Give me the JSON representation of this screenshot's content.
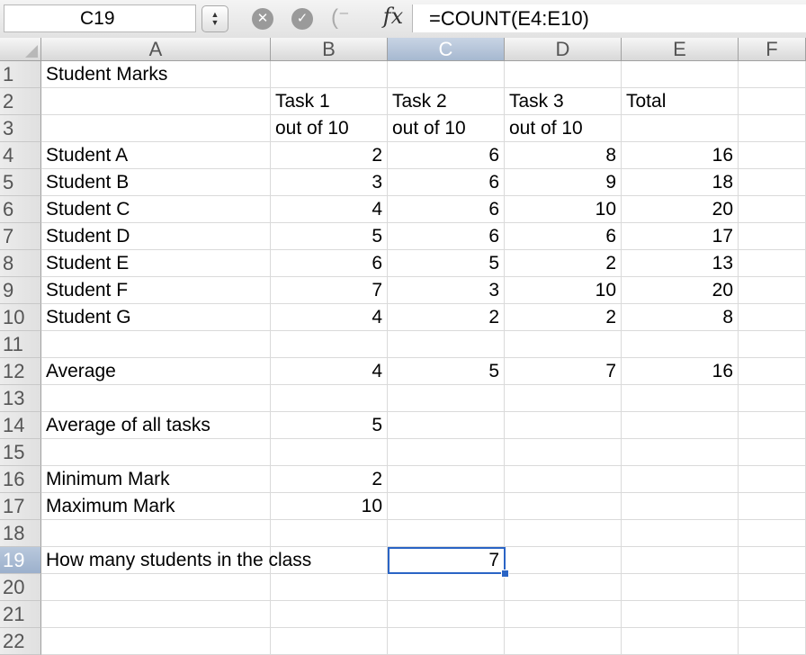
{
  "name_box": "C19",
  "formula": "=COUNT(E4:E10)",
  "fx_label": "fx",
  "icons": {
    "cancel": "x-circle-icon",
    "enter": "check-circle-icon",
    "stepper": "up-down-stepper-icon"
  },
  "colors": {
    "selection": "#2a64c5",
    "cancel": "#9a9a9a",
    "enter": "#9a9a9a"
  },
  "columns": [
    "A",
    "B",
    "C",
    "D",
    "E",
    "F"
  ],
  "selected_column": "C",
  "selected_row": "19",
  "rows": [
    {
      "n": "1",
      "cells": [
        "Student Marks",
        "",
        "",
        "",
        "",
        ""
      ]
    },
    {
      "n": "2",
      "cells": [
        "",
        "Task 1",
        "Task 2",
        "Task 3",
        "Total",
        ""
      ]
    },
    {
      "n": "3",
      "cells": [
        "",
        "out of 10",
        "out of 10",
        "out of 10",
        "",
        ""
      ]
    },
    {
      "n": "4",
      "cells": [
        "Student A",
        "2",
        "6",
        "8",
        "16",
        ""
      ]
    },
    {
      "n": "5",
      "cells": [
        "Student B",
        "3",
        "6",
        "9",
        "18",
        ""
      ]
    },
    {
      "n": "6",
      "cells": [
        "Student C",
        "4",
        "6",
        "10",
        "20",
        ""
      ]
    },
    {
      "n": "7",
      "cells": [
        "Student D",
        "5",
        "6",
        "6",
        "17",
        ""
      ]
    },
    {
      "n": "8",
      "cells": [
        "Student E",
        "6",
        "5",
        "2",
        "13",
        ""
      ]
    },
    {
      "n": "9",
      "cells": [
        "Student F",
        "7",
        "3",
        "10",
        "20",
        ""
      ]
    },
    {
      "n": "10",
      "cells": [
        "Student G",
        "4",
        "2",
        "2",
        "8",
        ""
      ]
    },
    {
      "n": "11",
      "cells": [
        "",
        "",
        "",
        "",
        "",
        ""
      ]
    },
    {
      "n": "12",
      "cells": [
        "Average",
        "4",
        "5",
        "7",
        "16",
        ""
      ]
    },
    {
      "n": "13",
      "cells": [
        "",
        "",
        "",
        "",
        "",
        ""
      ]
    },
    {
      "n": "14",
      "cells": [
        "Average of all tasks",
        "5",
        "",
        "",
        "",
        ""
      ]
    },
    {
      "n": "15",
      "cells": [
        "",
        "",
        "",
        "",
        "",
        ""
      ]
    },
    {
      "n": "16",
      "cells": [
        "Minimum Mark",
        "2",
        "",
        "",
        "",
        ""
      ]
    },
    {
      "n": "17",
      "cells": [
        "Maximum Mark",
        "10",
        "",
        "",
        "",
        ""
      ]
    },
    {
      "n": "18",
      "cells": [
        "",
        "",
        "",
        "",
        "",
        ""
      ]
    },
    {
      "n": "19",
      "cells": [
        "How many students in the class",
        "",
        "7",
        "",
        "",
        ""
      ]
    },
    {
      "n": "20",
      "cells": [
        "",
        "",
        "",
        "",
        "",
        ""
      ]
    },
    {
      "n": "21",
      "cells": [
        "",
        "",
        "",
        "",
        "",
        ""
      ]
    },
    {
      "n": "22",
      "cells": [
        "",
        "",
        "",
        "",
        "",
        ""
      ]
    }
  ]
}
